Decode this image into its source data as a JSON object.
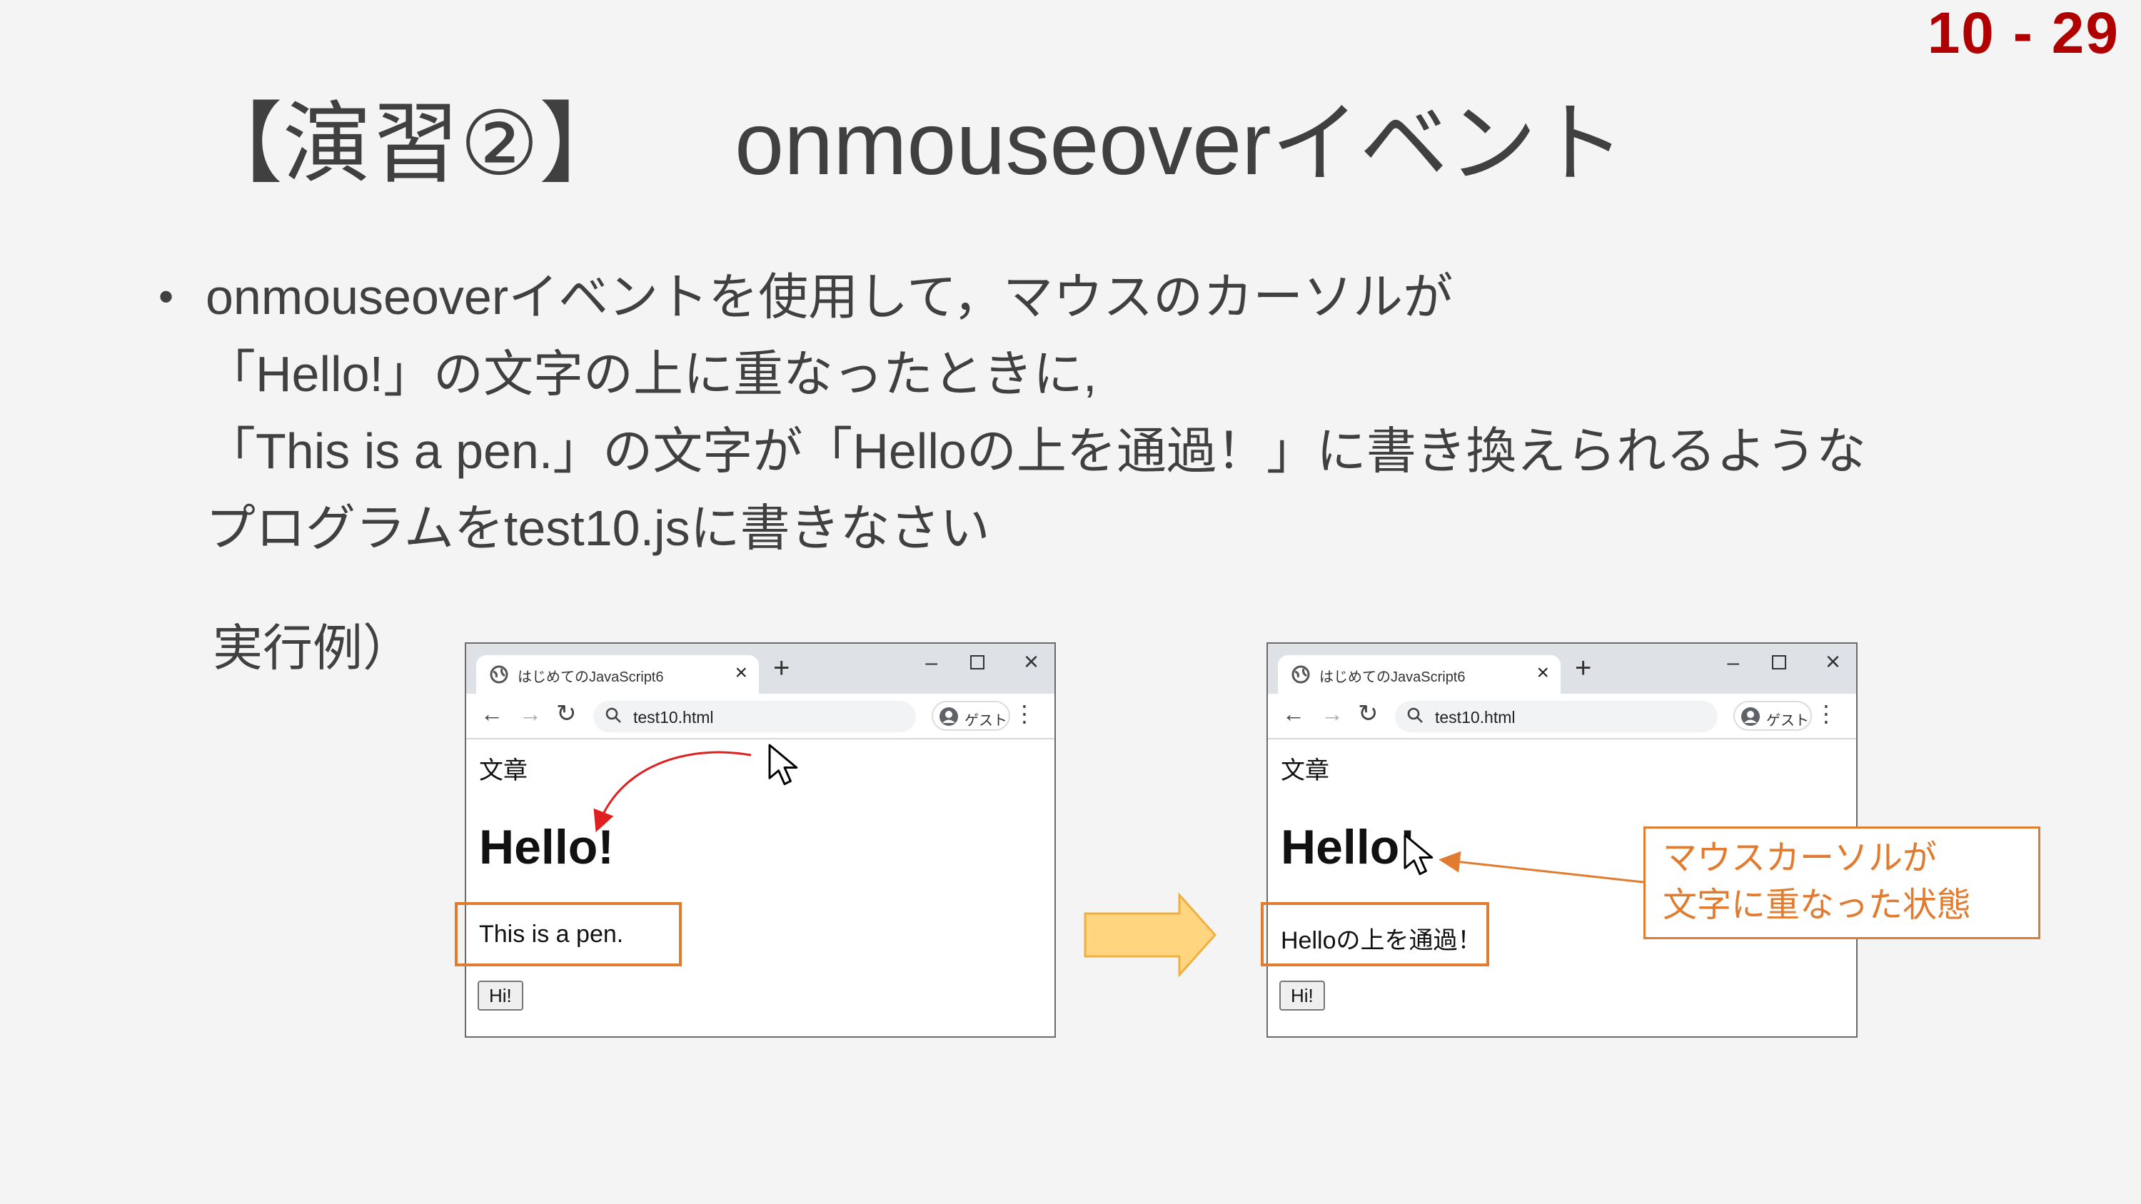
{
  "slide": {
    "page_number": "10 - 29",
    "title_part1": "【演習②】",
    "title_part2": "onmouseoverイベント",
    "bullet_lines": [
      "onmouseoverイベントを使用して，マウスのカーソルが",
      "「Hello!」の文字の上に重なったときに,",
      "「This is a pen.」の文字が「Helloの上を通過！」に書き換えられるような",
      "プログラムをtest10.jsに書きなさい"
    ],
    "example_label": "実行例）",
    "callout_lines": [
      "マウスカーソルが",
      "文字に重なった状態"
    ]
  },
  "browser_before": {
    "tab_title": "はじめてのJavaScript6",
    "url": "test10.html",
    "profile_label": "ゲスト",
    "heading": "文章",
    "hello": "Hello!",
    "paragraph": "This is a pen.",
    "button_label": "Hi!"
  },
  "browser_after": {
    "tab_title": "はじめてのJavaScript6",
    "url": "test10.html",
    "profile_label": "ゲスト",
    "heading": "文章",
    "hello": "Hello!",
    "paragraph": "Helloの上を通過！",
    "button_label": "Hi!"
  },
  "colors": {
    "page_number": "#b00000",
    "highlight": "#e07b2f",
    "arrow_fill": "#ffd580",
    "curve_arrow": "#e02020"
  },
  "icons": {
    "tab": "globe-icon",
    "close": "close-icon",
    "new_tab": "plus-icon",
    "back": "back-arrow-icon",
    "forward": "forward-arrow-icon",
    "reload": "reload-icon",
    "search": "search-icon",
    "profile": "avatar-icon",
    "menu": "menu-dots-icon",
    "cursor": "mouse-pointer-icon",
    "transition": "right-arrow-icon"
  }
}
